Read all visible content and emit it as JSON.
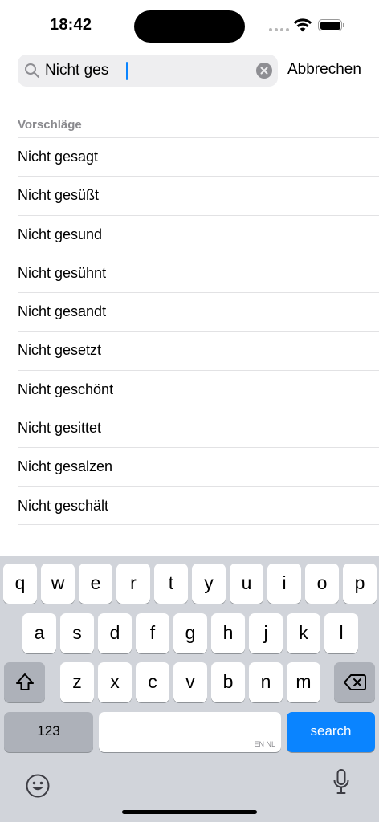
{
  "status_bar": {
    "time": "18:42"
  },
  "search": {
    "value": "Nicht ges"
  },
  "cancel_label": "Abbrechen",
  "suggestions": {
    "header": "Vorschläge",
    "items": [
      "Nicht gesagt",
      "Nicht gesüßt",
      "Nicht gesund",
      "Nicht gesühnt",
      "Nicht gesandt",
      "Nicht gesetzt",
      "Nicht geschönt",
      "Nicht gesittet",
      "Nicht gesalzen",
      "Nicht geschält"
    ]
  },
  "keyboard": {
    "row1": [
      "q",
      "w",
      "e",
      "r",
      "t",
      "y",
      "u",
      "i",
      "o",
      "p"
    ],
    "row2": [
      "a",
      "s",
      "d",
      "f",
      "g",
      "h",
      "j",
      "k",
      "l"
    ],
    "row3": [
      "z",
      "x",
      "c",
      "v",
      "b",
      "n",
      "m"
    ],
    "numbers_label": "123",
    "space_language": "EN NL",
    "search_label": "search",
    "icons": {
      "shift": "shift-icon",
      "delete": "delete-icon",
      "emoji": "emoji-icon",
      "mic": "mic-icon"
    }
  },
  "colors": {
    "accent": "#0a84ff",
    "keyboard_bg": "#d1d4da"
  }
}
